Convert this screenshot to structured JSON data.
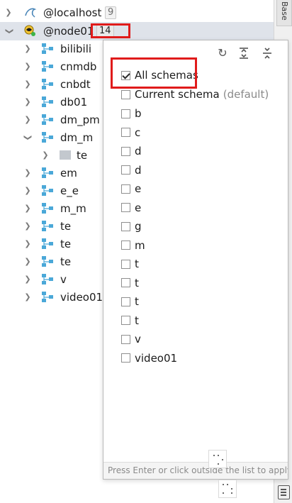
{
  "tree": {
    "localhost": {
      "label": "@localhost",
      "count": "9"
    },
    "node01": {
      "label": "@node01",
      "count": "14"
    },
    "schemas": [
      {
        "label": "bilibili",
        "expanded": false
      },
      {
        "label": "cnmdb",
        "expanded": false
      },
      {
        "label": "cnbdt",
        "expanded": false
      },
      {
        "label": "db01",
        "expanded": false
      },
      {
        "label": "dm_pm",
        "expanded": false
      },
      {
        "label": "dm_m",
        "expanded": true,
        "child": "te"
      },
      {
        "label": "em",
        "expanded": false
      },
      {
        "label": "e_e",
        "expanded": false
      },
      {
        "label": "m_m",
        "expanded": false
      },
      {
        "label": "te",
        "expanded": false
      },
      {
        "label": "te",
        "expanded": false
      },
      {
        "label": "te",
        "expanded": false
      },
      {
        "label": "v",
        "expanded": false
      },
      {
        "label": "video01",
        "expanded": false
      }
    ]
  },
  "right_strip": {
    "tab_label": "Base"
  },
  "popup": {
    "all_schemas": {
      "label": "All schemas",
      "checked": true
    },
    "current_schema": {
      "label": "Current schema",
      "note": "(default)",
      "checked": false
    },
    "schemas": [
      {
        "label": "b",
        "checked": false
      },
      {
        "label": "c",
        "checked": false
      },
      {
        "label": "d",
        "checked": false
      },
      {
        "label": "d",
        "checked": false
      },
      {
        "label": "e",
        "checked": false
      },
      {
        "label": "e",
        "checked": false
      },
      {
        "label": "g",
        "checked": false
      },
      {
        "label": "m",
        "checked": false
      },
      {
        "label": "t",
        "checked": false
      },
      {
        "label": "t",
        "checked": false
      },
      {
        "label": "t",
        "checked": false
      },
      {
        "label": "t",
        "checked": false
      },
      {
        "label": "v",
        "checked": false
      },
      {
        "label": "video01",
        "checked": false
      }
    ],
    "footer": "Press Enter or click outside the list to apply"
  },
  "colors": {
    "highlight": "#e01b1b",
    "schema_icon": "#4aa8d8",
    "selected_row": "#dfe3ea"
  }
}
